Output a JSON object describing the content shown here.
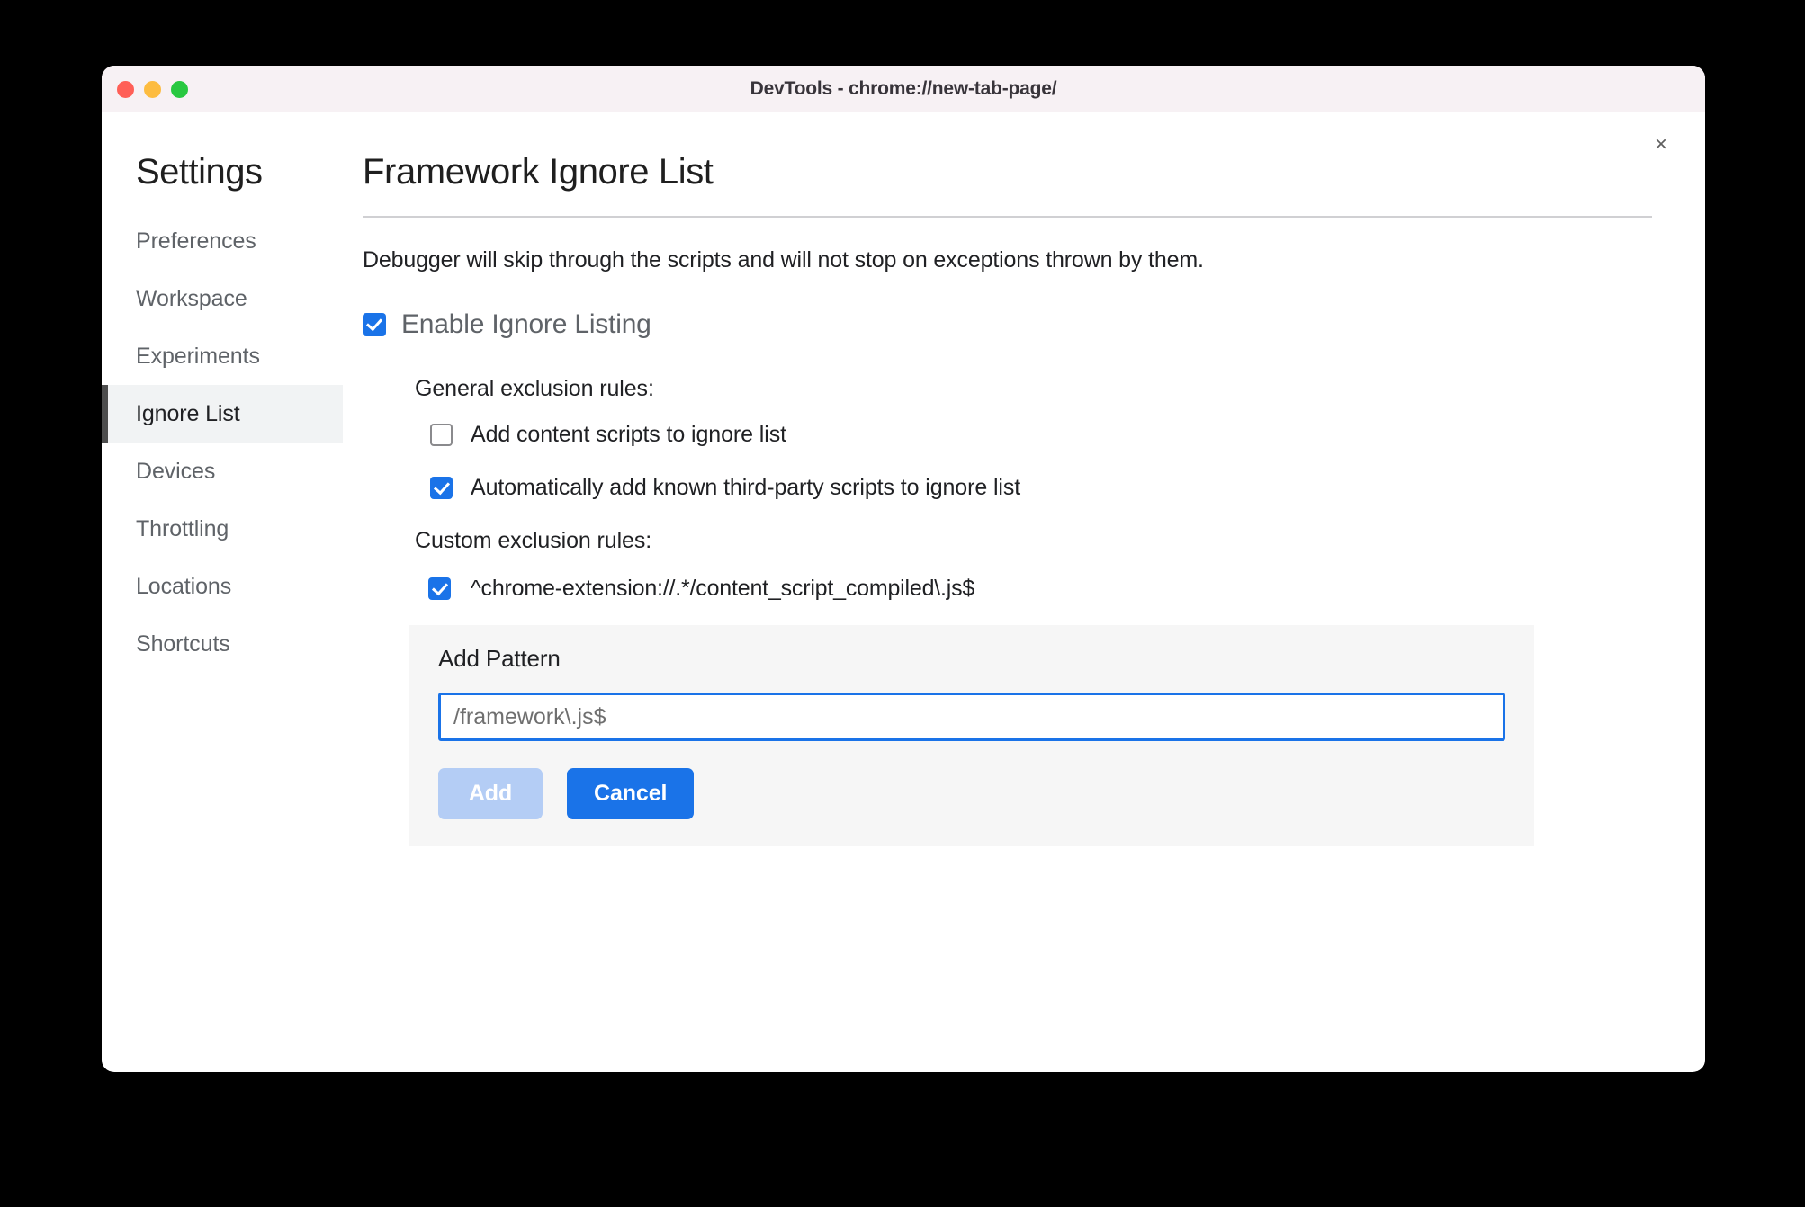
{
  "window": {
    "title": "DevTools - chrome://new-tab-page/",
    "close_label": "×",
    "traffic_lights": {
      "close_color": "#ff5f57",
      "minimize_color": "#fdbc40",
      "maximize_color": "#28c840"
    }
  },
  "sidebar": {
    "title": "Settings",
    "items": [
      {
        "label": "Preferences",
        "selected": false
      },
      {
        "label": "Workspace",
        "selected": false
      },
      {
        "label": "Experiments",
        "selected": false
      },
      {
        "label": "Ignore List",
        "selected": true
      },
      {
        "label": "Devices",
        "selected": false
      },
      {
        "label": "Throttling",
        "selected": false
      },
      {
        "label": "Locations",
        "selected": false
      },
      {
        "label": "Shortcuts",
        "selected": false
      }
    ]
  },
  "main": {
    "page_title": "Framework Ignore List",
    "description": "Debugger will skip through the scripts and will not stop on exceptions thrown by them.",
    "enable_ignore_listing": {
      "label": "Enable Ignore Listing",
      "checked": true
    },
    "general_rules": {
      "label": "General exclusion rules:",
      "items": [
        {
          "label": "Add content scripts to ignore list",
          "checked": false
        },
        {
          "label": "Automatically add known third-party scripts to ignore list",
          "checked": true
        }
      ]
    },
    "custom_rules": {
      "label": "Custom exclusion rules:",
      "items": [
        {
          "pattern": "^chrome-extension://.*/content_script_compiled\\.js$",
          "checked": true
        }
      ]
    },
    "add_pattern": {
      "title": "Add Pattern",
      "input_value": "",
      "input_placeholder": "/framework\\.js$",
      "add_label": "Add",
      "cancel_label": "Cancel",
      "add_disabled": true
    }
  },
  "colors": {
    "accent": "#1a73e8",
    "accent_disabled": "#b4cdf5",
    "selected_nav_bg": "#f1f3f4",
    "selected_nav_bar": "#4d4d4d",
    "panel_bg": "#f6f6f6",
    "titlebar_bg": "#f7f1f4"
  }
}
